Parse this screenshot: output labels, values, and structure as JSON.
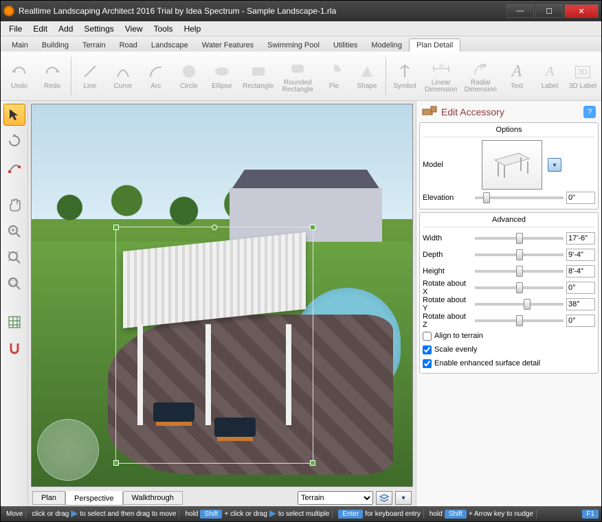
{
  "titlebar": {
    "title": "Realtime Landscaping Architect 2016 Trial by Idea Spectrum - Sample Landscape-1.rla"
  },
  "menubar": [
    "File",
    "Edit",
    "Add",
    "Settings",
    "View",
    "Tools",
    "Help"
  ],
  "ribbon_tabs": [
    "Main",
    "Building",
    "Terrain",
    "Road",
    "Landscape",
    "Water Features",
    "Swimming Pool",
    "Utilities",
    "Modeling",
    "Plan Detail"
  ],
  "ribbon_active": 9,
  "toolbar": {
    "undo": "Undo",
    "redo": "Redo",
    "line": "Line",
    "curve": "Curve",
    "arc": "Arc",
    "circle": "Circle",
    "ellipse": "Ellipse",
    "rectangle": "Rectangle",
    "rounded_rect": "Rounded Rectangle",
    "pie": "Pie",
    "shape": "Shape",
    "symbol": "Symbol",
    "linear_dim": "Linear Dimension",
    "radial_dim": "Radial Dimension",
    "text": "Text",
    "label": "Label",
    "label3d": "3D Label"
  },
  "view_tabs": {
    "plan": "Plan",
    "perspective": "Perspective",
    "walkthrough": "Walkthrough",
    "active": 1
  },
  "view_dropdown": "Terrain",
  "panel": {
    "title": "Edit Accessory",
    "options_title": "Options",
    "model_label": "Model",
    "elevation_label": "Elevation",
    "elevation_value": "0\"",
    "advanced_title": "Advanced",
    "width_label": "Width",
    "width_value": "17'-6\"",
    "depth_label": "Depth",
    "depth_value": "9'-4\"",
    "height_label": "Height",
    "height_value": "8'-4\"",
    "rotx_label": "Rotate about X",
    "rotx_value": "0°",
    "roty_label": "Rotate about Y",
    "roty_value": "38°",
    "rotz_label": "Rotate about Z",
    "rotz_value": "0°",
    "align_label": "Align to terrain",
    "align_checked": false,
    "scale_label": "Scale evenly",
    "scale_checked": true,
    "detail_label": "Enable enhanced surface detail",
    "detail_checked": true
  },
  "statusbar": {
    "tool": "Move",
    "seg1a": "click or drag",
    "seg1b": "to select and then drag to move",
    "seg2a": "hold",
    "shift": "Shift",
    "seg2b": "+ click or drag",
    "seg2c": "to select multiple",
    "enter": "Enter",
    "seg3": "for keyboard entry",
    "seg4a": "hold",
    "seg4b": "+ Arrow key to nudge",
    "f1": "F1"
  }
}
